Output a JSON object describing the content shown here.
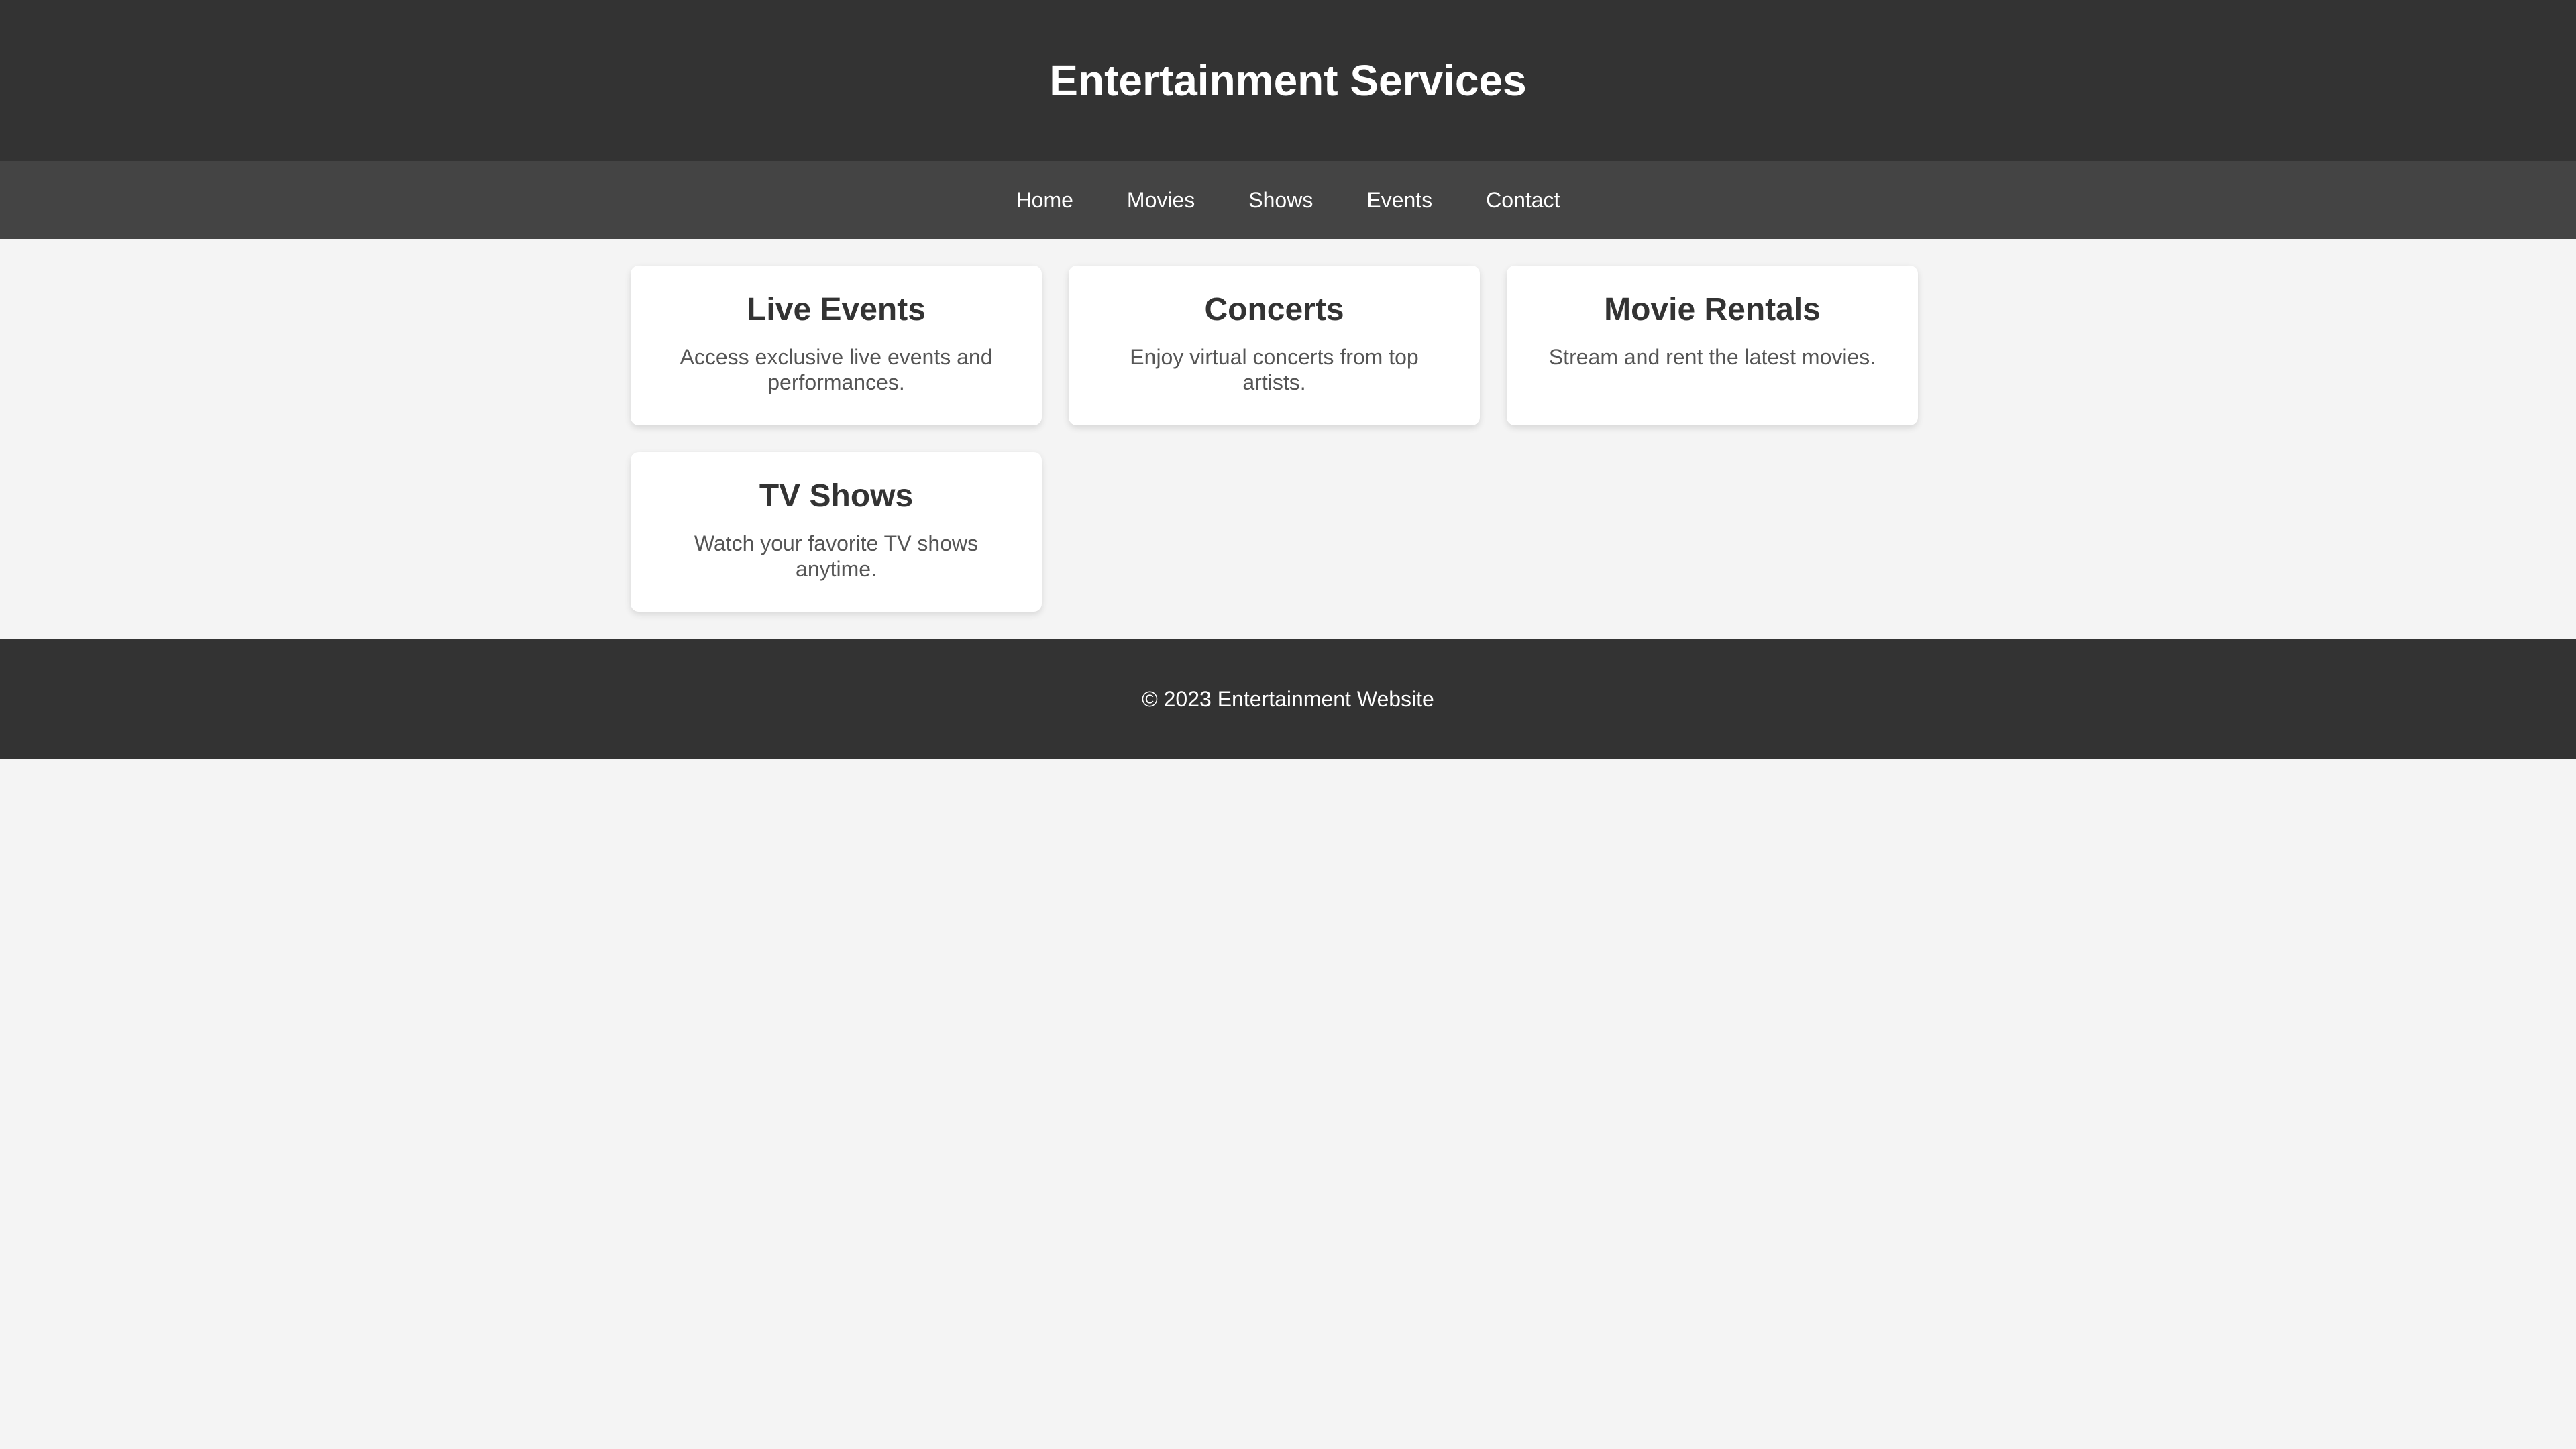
{
  "header": {
    "title": "Entertainment Services"
  },
  "nav": {
    "items": [
      {
        "label": "Home"
      },
      {
        "label": "Movies"
      },
      {
        "label": "Shows"
      },
      {
        "label": "Events"
      },
      {
        "label": "Contact"
      }
    ]
  },
  "cards": [
    {
      "title": "Live Events",
      "description": "Access exclusive live events and performances."
    },
    {
      "title": "Concerts",
      "description": "Enjoy virtual concerts from top artists."
    },
    {
      "title": "Movie Rentals",
      "description": "Stream and rent the latest movies."
    },
    {
      "title": "TV Shows",
      "description": "Watch your favorite TV shows anytime."
    }
  ],
  "footer": {
    "text": "© 2023 Entertainment Website"
  },
  "colors": {
    "header_bg": "#333333",
    "nav_bg": "#444444",
    "page_bg": "#f4f4f4",
    "card_bg": "#ffffff",
    "footer_bg": "#333333"
  }
}
